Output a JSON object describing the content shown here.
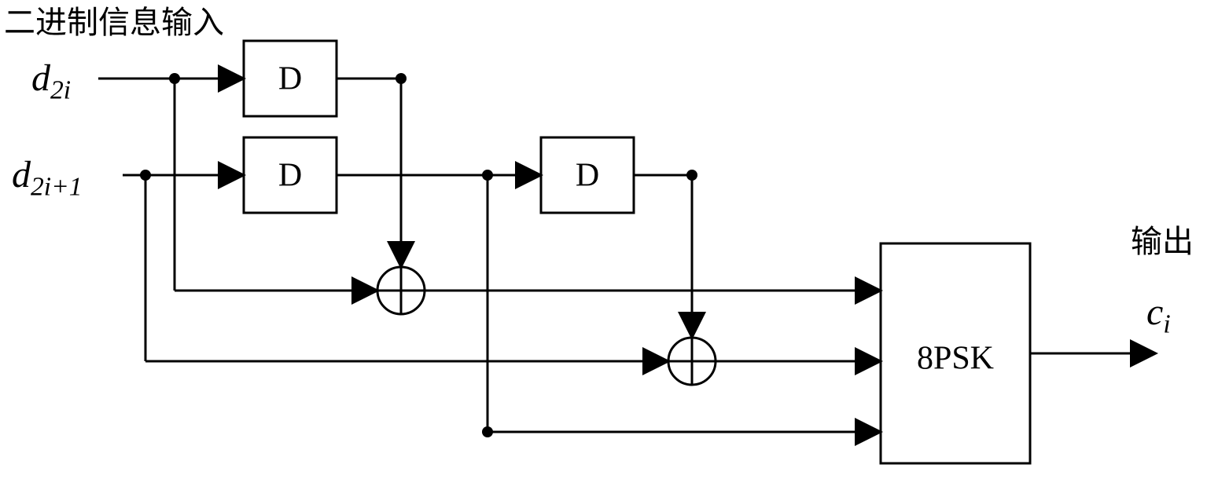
{
  "title": "二进制信息输入",
  "in_top": "d",
  "in_top_sub": "2i",
  "in_bot": "d",
  "in_bot_sub": "2i+1",
  "delay1": "D",
  "delay2": "D",
  "delay3": "D",
  "mapper": "8PSK",
  "out_label": "输出",
  "out_sym": "c",
  "out_sym_sub": "i"
}
